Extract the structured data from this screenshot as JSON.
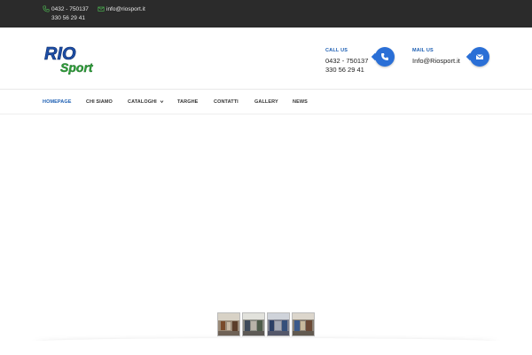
{
  "topbar": {
    "phone_1": "0432 - 750137",
    "phone_2": "330 56 29 41",
    "email": "info@riosport.it",
    "phone_icon": "phone-icon",
    "email_icon": "envelope-icon",
    "icon_color": "#4caf50"
  },
  "logo": {
    "text_top": "RIO",
    "text_bottom": "Sport",
    "color_primary": "#1d4fa8",
    "color_secondary": "#2e9e3a"
  },
  "header": {
    "call": {
      "label": "CALL US",
      "line1": "0432 - 750137",
      "line2": "330 56 29 41",
      "icon": "phone-icon"
    },
    "mail": {
      "label": "MAIL US",
      "line1": "Info@Riosport.it",
      "icon": "envelope-icon"
    },
    "accent": "#2a6fd6"
  },
  "nav": {
    "items": [
      {
        "label": "HOMEPAGE",
        "active": true
      },
      {
        "label": "CHI SIAMO"
      },
      {
        "label": "CATALOGHI",
        "dropdown": true
      },
      {
        "label": "TARGHE"
      },
      {
        "label": "CONTATTI"
      },
      {
        "label": "GALLERY"
      },
      {
        "label": "NEWS"
      }
    ],
    "active_color": "#1d5fb3"
  },
  "slider": {
    "thumbnails": [
      "shop-photo-1",
      "shop-photo-2",
      "shop-photo-3",
      "shop-photo-4"
    ]
  }
}
